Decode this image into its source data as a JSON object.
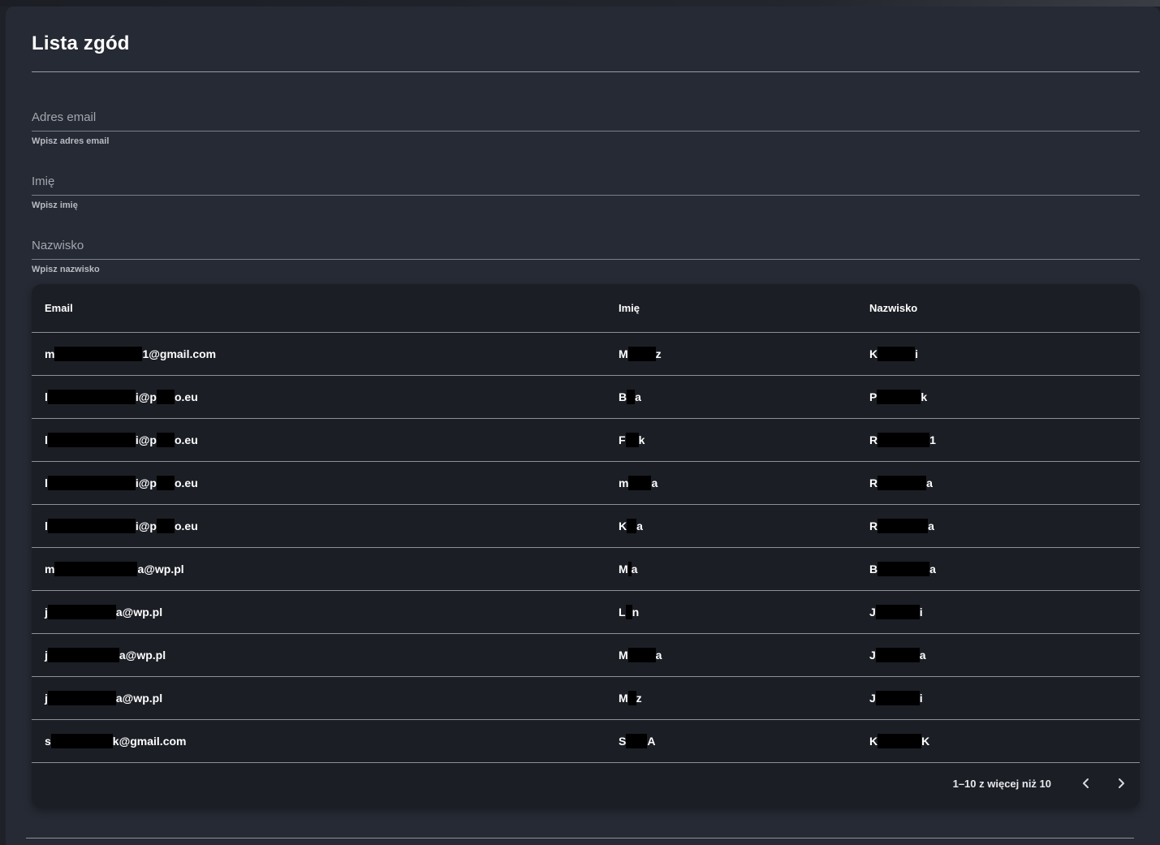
{
  "page": {
    "title": "Lista zgód"
  },
  "filters": {
    "email": {
      "label": "Adres email",
      "hint": "Wpisz adres email"
    },
    "first_name": {
      "label": "Imię",
      "hint": "Wpisz imię"
    },
    "last_name": {
      "label": "Nazwisko",
      "hint": "Wpisz nazwisko"
    }
  },
  "table": {
    "headers": {
      "email": "Email",
      "first_name": "Imię",
      "last_name": "Nazwisko"
    },
    "rows": [
      {
        "email": [
          "m",
          "1@gmail.com"
        ],
        "first": [
          "M",
          "z"
        ],
        "last": [
          "K",
          "i"
        ]
      },
      {
        "email": [
          "l",
          "i@p",
          "o.eu"
        ],
        "first": [
          "B",
          "a"
        ],
        "last": [
          "P",
          "k"
        ]
      },
      {
        "email": [
          "l",
          "i@p",
          "o.eu"
        ],
        "first": [
          "F",
          "k"
        ],
        "last": [
          "R",
          "1"
        ]
      },
      {
        "email": [
          "l",
          "i@p",
          "o.eu"
        ],
        "first": [
          "m",
          "a"
        ],
        "last": [
          "R",
          "a"
        ]
      },
      {
        "email": [
          "l",
          "i@p",
          "o.eu"
        ],
        "first": [
          "K",
          "a"
        ],
        "last": [
          "R",
          "a"
        ]
      },
      {
        "email": [
          "m",
          "a@wp.pl"
        ],
        "first": [
          "M",
          "a"
        ],
        "last": [
          "B",
          "a"
        ]
      },
      {
        "email": [
          "j",
          "a@wp.pl"
        ],
        "first": [
          "L",
          "n"
        ],
        "last": [
          "J",
          "i"
        ]
      },
      {
        "email": [
          "j",
          "a@wp.pl"
        ],
        "first": [
          "M",
          "a"
        ],
        "last": [
          "J",
          "a"
        ]
      },
      {
        "email": [
          "j",
          "a@wp.pl"
        ],
        "first": [
          "M",
          "z"
        ],
        "last": [
          "J",
          "i"
        ]
      },
      {
        "email": [
          "s",
          "k@gmail.com"
        ],
        "first": [
          "S",
          "A"
        ],
        "last": [
          "K",
          "K"
        ]
      }
    ]
  },
  "pagination": {
    "text": "1–10 z więcej niż 10",
    "prev_icon": "chevron-left-icon",
    "next_icon": "chevron-right-icon"
  },
  "colors": {
    "panel": "#262a34",
    "table": "#1b1e25",
    "background": "#1e2128"
  }
}
